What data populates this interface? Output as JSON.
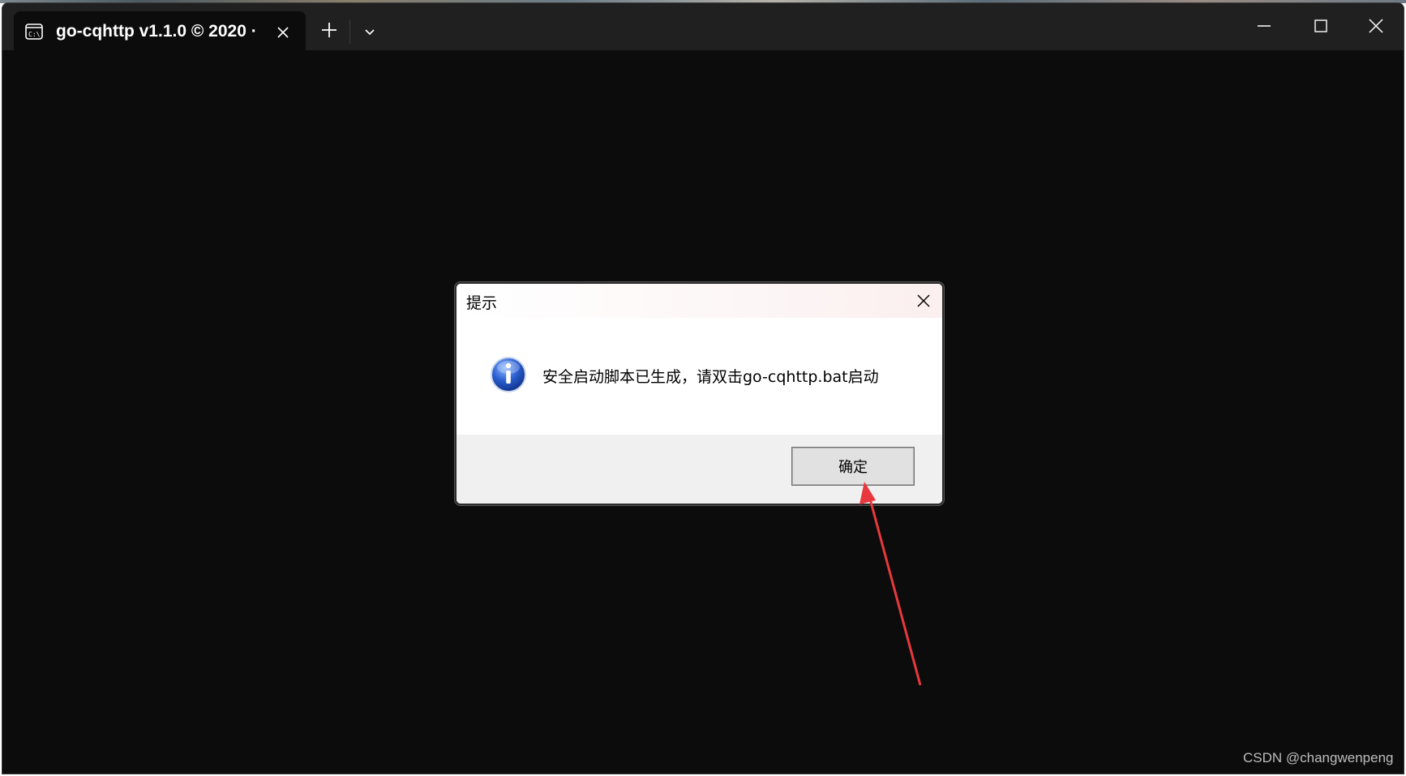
{
  "window": {
    "tab_title": "go-cqhttp v1.1.0 © 2020 ·",
    "tab_icon": "terminal-icon",
    "new_tab_icon": "plus-icon",
    "dropdown_icon": "chevron-down-icon",
    "controls": [
      "minimize-icon",
      "maximize-icon",
      "close-icon"
    ]
  },
  "dialog": {
    "title": "提示",
    "icon": "info-icon",
    "message": "安全启动脚本已生成，请双击go-cqhttp.bat启动",
    "ok_label": "确定"
  },
  "annotation": {
    "arrow_color": "#e8383d"
  },
  "watermark": "CSDN @changwenpeng"
}
